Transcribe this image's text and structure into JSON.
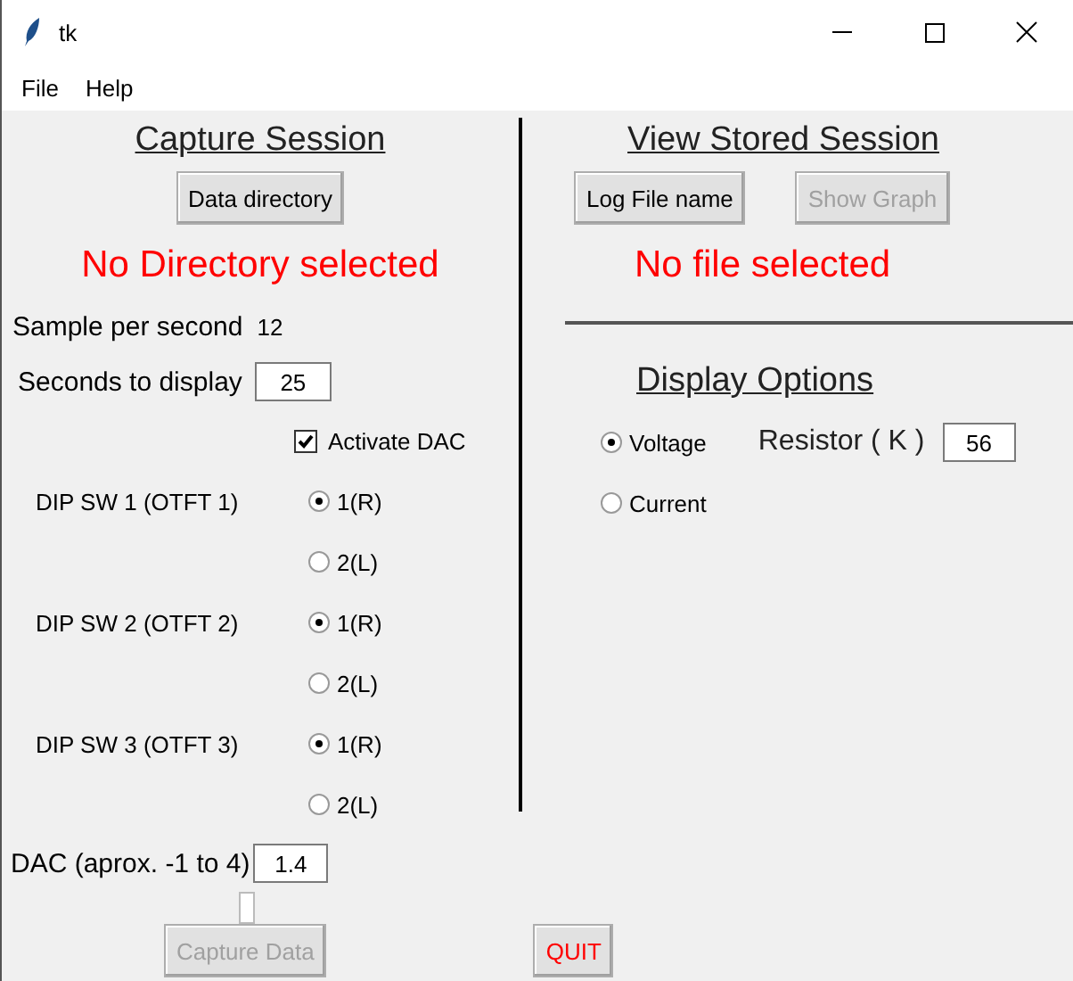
{
  "window": {
    "title": "tk"
  },
  "menu": [
    "File",
    "Help"
  ],
  "capture": {
    "heading": "Capture Session",
    "directory_button": {
      "label": "Data directory",
      "disabled": false
    },
    "status": "No Directory selected",
    "sample_rate": {
      "label": "Sample per second",
      "value": "12"
    },
    "seconds": {
      "label": "Seconds to display",
      "value": "25"
    },
    "activate_dac": {
      "label": "Activate DAC",
      "checked": true
    },
    "dip_switches": [
      {
        "label": "DIP SW 1 (OTFT 1)",
        "options": [
          {
            "label": "1(R)",
            "selected": true
          },
          {
            "label": "2(L)",
            "selected": false
          }
        ]
      },
      {
        "label": "DIP SW 2 (OTFT 2)",
        "options": [
          {
            "label": "1(R)",
            "selected": true
          },
          {
            "label": "2(L)",
            "selected": false
          }
        ]
      },
      {
        "label": "DIP SW 3 (OTFT 3)",
        "options": [
          {
            "label": "1(R)",
            "selected": true
          },
          {
            "label": "2(L)",
            "selected": false
          }
        ]
      }
    ],
    "dac": {
      "label": "DAC (aprox. -1 to 4)",
      "value": "1.4"
    },
    "capture_button": {
      "label": "Capture Data",
      "disabled": true
    },
    "quit_button": {
      "label": "QUIT",
      "disabled": false
    }
  },
  "stored": {
    "heading": "View Stored Session",
    "log_button": {
      "label": "Log File name",
      "disabled": false
    },
    "graph_button": {
      "label": "Show Graph",
      "disabled": true
    },
    "status": "No file selected"
  },
  "display": {
    "heading": "Display Options",
    "modes": [
      {
        "label": "Voltage",
        "selected": true
      },
      {
        "label": "Current",
        "selected": false
      }
    ],
    "resistor": {
      "label": "Resistor ( K )",
      "value": "56"
    }
  }
}
